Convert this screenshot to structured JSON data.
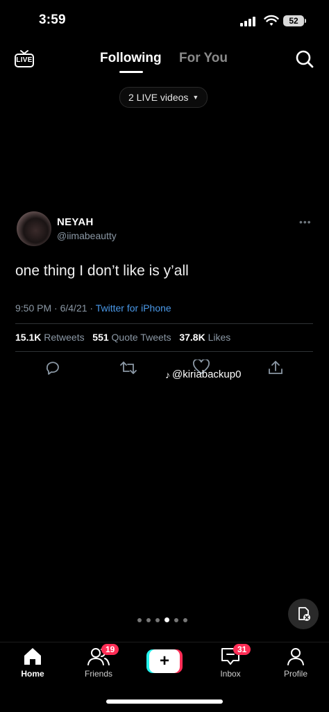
{
  "status_bar": {
    "time": "3:59",
    "battery": "52"
  },
  "top_nav": {
    "live_label": "LIVE",
    "tabs": [
      {
        "label": "Following",
        "active": true
      },
      {
        "label": "For You",
        "active": false
      }
    ],
    "live_pill": "2 LIVE videos"
  },
  "tweet": {
    "name": "NEYAH",
    "handle": "@iimabeautty",
    "more": "•••",
    "text": "one thing I don’t like is y’all",
    "time": "9:50 PM",
    "date": "6/4/21",
    "source": "Twitter for iPhone",
    "retweets": "15.1K",
    "retweets_label": "Retweets",
    "quotes": "551",
    "quotes_label": "Quote Tweets",
    "likes": "37.8K",
    "likes_label": "Likes"
  },
  "watermark": "@kiriabackup0",
  "pager": {
    "count": 6,
    "active_index": 3
  },
  "bottom_nav": {
    "home": "Home",
    "friends": "Friends",
    "friends_badge": "19",
    "create": "+",
    "inbox": "Inbox",
    "inbox_badge": "31",
    "profile": "Profile"
  },
  "colors": {
    "accent_pink": "#fe2c55",
    "accent_cyan": "#25f4ee",
    "link_blue": "#4a99e9",
    "badge_red": "#ff2d55"
  }
}
